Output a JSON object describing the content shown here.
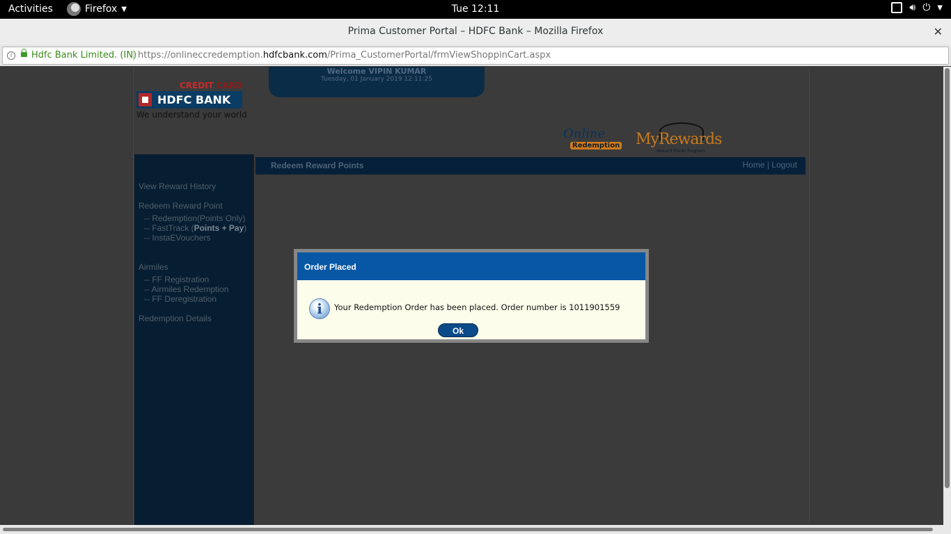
{
  "gnome": {
    "activities": "Activities",
    "app_menu": "Firefox",
    "clock": "Tue 12:11"
  },
  "firefox": {
    "window_title": "Prima Customer Portal – HDFC Bank – Mozilla Firefox",
    "site_identity": "Hdfc Bank Limited. (IN)",
    "url_prefix": "https://onlineccredemption.",
    "url_domain": "hdfcbank.com",
    "url_path": "/Prima_CustomerPortal/frmViewShoppinCart.aspx"
  },
  "header": {
    "credit_card_red": "CREDIT ",
    "credit_card_dark": "CARD",
    "bank_name": "HDFC BANK",
    "tagline": "We understand your world",
    "welcome": "Welcome  VIPIN KUMAR",
    "datetime": "Tuesday, 01 January 2019 12:11:25",
    "logo_online": "Online",
    "logo_redemption": "Redemption",
    "logo_my": "My",
    "logo_rewards": "Rewards",
    "logo_rewards_sub": "Reward Points Program"
  },
  "sidebar": {
    "view_history": "View Reward History",
    "redeem_points": "Redeem Reward Point",
    "redemption_points_only": "-- Redemption(Points Only)",
    "fasttrack_prefix": "-- FastTrack (",
    "fasttrack_bold": "Points + Pay",
    "fasttrack_suffix": ")",
    "instaevouchers": "-- InstaEVouchers",
    "airmiles": "Airmiles",
    "ff_registration": "-- FF Registration",
    "airmiles_redemption": "-- Airmiles Redemption",
    "ff_deregistration": "-- FF Deregistration",
    "redemption_details": "Redemption Details"
  },
  "navbar": {
    "title": "Redeem Reward Points",
    "home": "Home",
    "separator": "| ",
    "logout": "Logout"
  },
  "dialog": {
    "title": "Order Placed",
    "message": "Your Redemption Order has been placed. Order number is 1011901559",
    "ok": "Ok"
  }
}
